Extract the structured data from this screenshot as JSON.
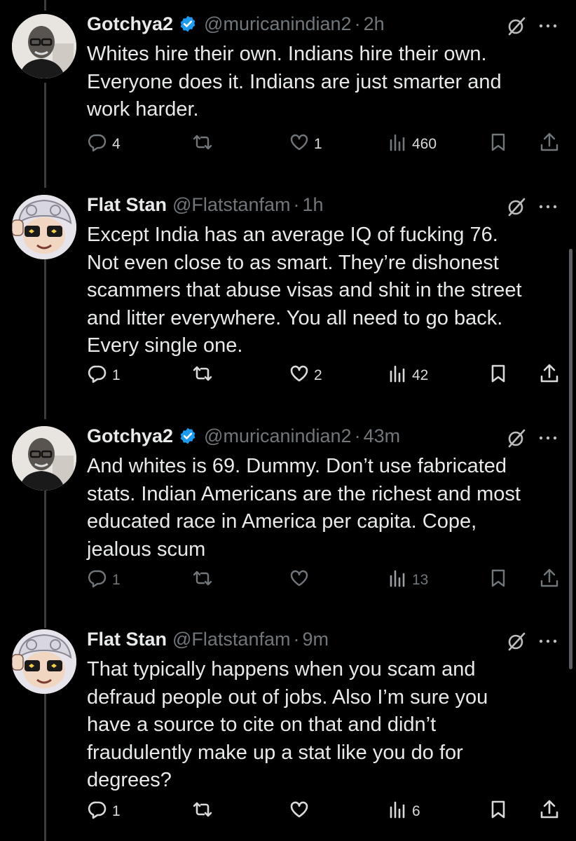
{
  "tweets": [
    {
      "name": "Gotchya2",
      "verified": true,
      "handle": "@muricanindian2",
      "time": "2h",
      "avatar_icon": "bald-man-glasses-avatar",
      "text": "Whites hire their own. Indians hire their own.\nEveryone does it. Indians are just smarter and\nwork harder.",
      "replies": "4",
      "reposts": "",
      "likes": "1",
      "views": "460"
    },
    {
      "name": "Flat Stan",
      "verified": false,
      "handle": "@Flatstanfam",
      "time": "1h",
      "avatar_icon": "cartoon-glasses-avatar",
      "text": "Except India has an average IQ of fucking 76.\nNot even close to as smart. They’re dishonest\nscammers that abuse visas and shit in the street\nand litter everywhere. You all need to go back.\nEvery single one.",
      "replies": "1",
      "reposts": "",
      "likes": "2",
      "views": "42"
    },
    {
      "name": "Gotchya2",
      "verified": true,
      "handle": "@muricanindian2",
      "time": "43m",
      "avatar_icon": "bald-man-glasses-avatar",
      "text": "And whites is 69. Dummy. Don’t use fabricated\nstats. Indian Americans are the richest and most\neducated race in America per capita. Cope,\njealous scum",
      "replies": "1",
      "reposts": "",
      "likes": "",
      "views": "13"
    },
    {
      "name": "Flat Stan",
      "verified": false,
      "handle": "@Flatstanfam",
      "time": "9m",
      "avatar_icon": "cartoon-glasses-avatar",
      "text": "That typically happens when you scam and\ndefraud people out of jobs. Also I’m sure you\nhave a source to cite on that and didn’t\nfraudulently make up a stat like you do for\ndegrees?",
      "replies": "1",
      "reposts": "",
      "likes": "",
      "views": "6"
    }
  ],
  "colors": {
    "background": "#000000",
    "text": "#e7e9ea",
    "muted": "#71767b",
    "verified_blue": "#1d9bf0"
  },
  "icons": [
    "reply-icon",
    "repost-icon",
    "like-icon",
    "views-icon",
    "bookmark-icon",
    "share-icon",
    "grok-icon",
    "more-icon",
    "verified-icon"
  ]
}
